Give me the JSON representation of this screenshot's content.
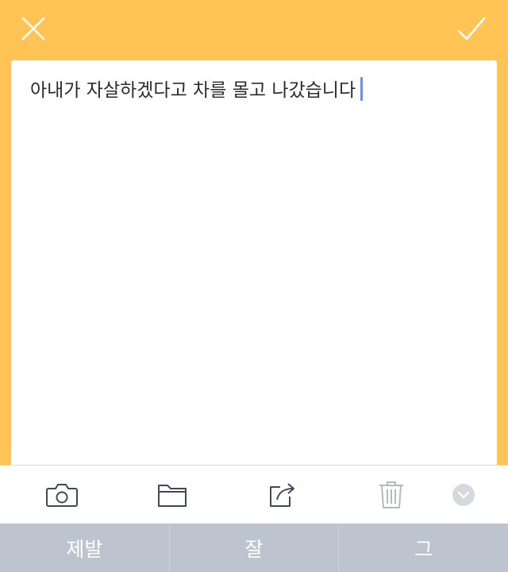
{
  "colors": {
    "accent_yellow": "#FFC454",
    "caret_blue": "#6D8FE8",
    "suggestion_bg": "#BEC4CF",
    "icon_gray": "#3E4A55",
    "disabled_gray": "#B5B9BE"
  },
  "header": {
    "close_icon": "close-icon",
    "confirm_icon": "checkmark-icon"
  },
  "note": {
    "text": "아내가 자살하겠다고 차를 몰고 나갔습니다"
  },
  "toolbar": {
    "items": [
      {
        "icon": "camera-icon",
        "enabled": true
      },
      {
        "icon": "folder-icon",
        "enabled": true
      },
      {
        "icon": "share-icon",
        "enabled": true
      },
      {
        "icon": "trash-icon",
        "enabled": false
      },
      {
        "icon": "chevron-down-circle-icon",
        "enabled": true
      }
    ]
  },
  "keyboard": {
    "suggestions": [
      "제발",
      "잘",
      "그"
    ]
  }
}
